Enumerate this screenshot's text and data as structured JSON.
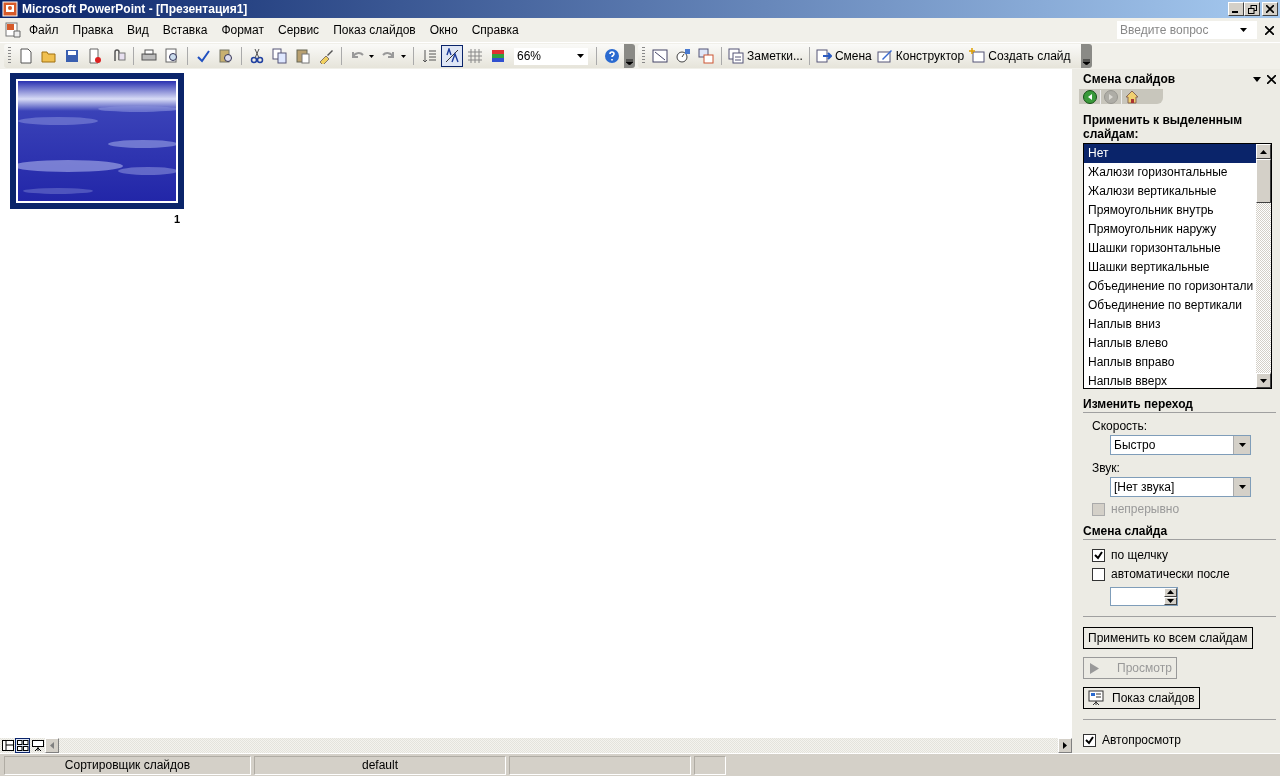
{
  "window": {
    "title": "Microsoft PowerPoint - [Презентация1]"
  },
  "menu": {
    "items": [
      "Файл",
      "Правка",
      "Вид",
      "Вставка",
      "Формат",
      "Сервис",
      "Показ слайдов",
      "Окно",
      "Справка"
    ],
    "help_placeholder": "Введите вопрос"
  },
  "toolbar": {
    "zoom": "66%",
    "formatting_toggle": {
      "on": true
    },
    "buttons": [
      {
        "label": "Заметки..."
      },
      {
        "label": "Смена"
      },
      {
        "label": "Конструктор"
      },
      {
        "label": "Создать слайд"
      }
    ]
  },
  "slides": [
    {
      "number": "1",
      "selected": true,
      "kind": "picture"
    }
  ],
  "task_pane": {
    "title": "Смена слайдов",
    "nav": [
      {
        "disabled": false
      },
      {
        "disabled": true
      },
      {
        "disabled": false
      }
    ],
    "apply_label": "Применить к выделенным слайдам:",
    "transitions": [
      {
        "label": "Нет",
        "selected": true
      },
      {
        "label": "Жалюзи горизонтальные",
        "selected": false
      },
      {
        "label": "Жалюзи вертикальные",
        "selected": false
      },
      {
        "label": "Прямоугольник внутрь",
        "selected": false
      },
      {
        "label": "Прямоугольник наружу",
        "selected": false
      },
      {
        "label": "Шашки горизонтальные",
        "selected": false
      },
      {
        "label": "Шашки вертикальные",
        "selected": false
      },
      {
        "label": "Объединение по горизонтали",
        "selected": false
      },
      {
        "label": "Объединение по вертикали",
        "selected": false
      },
      {
        "label": "Наплыв вниз",
        "selected": false
      },
      {
        "label": "Наплыв влево",
        "selected": false
      },
      {
        "label": "Наплыв вправо",
        "selected": false
      },
      {
        "label": "Наплыв вверх",
        "selected": false
      }
    ],
    "modify_heading": "Изменить переход",
    "speed": {
      "label": "Скорость:",
      "value": "Быстро"
    },
    "sound": {
      "label": "Звук:",
      "value": "[Нет звука]"
    },
    "loop": {
      "label": "непрерывно",
      "checked": false,
      "disabled": true
    },
    "advance_heading": "Смена слайда",
    "on_click": {
      "label": "по щелчку",
      "checked": true
    },
    "automatic": {
      "label": "автоматически после",
      "checked": false
    },
    "apply_all_button": {
      "label": "Применить ко всем слайдам",
      "disabled": false
    },
    "preview_button": {
      "label": "Просмотр",
      "disabled": true
    },
    "slideshow_button": {
      "label": "Показ слайдов",
      "disabled": false
    },
    "autopreview": {
      "label": "Автопросмотр",
      "checked": true
    }
  },
  "view_buttons": [
    {
      "selected": false
    },
    {
      "selected": true
    },
    {
      "selected": false
    }
  ],
  "status_bar": [
    "Сортировщик слайдов",
    "default"
  ]
}
